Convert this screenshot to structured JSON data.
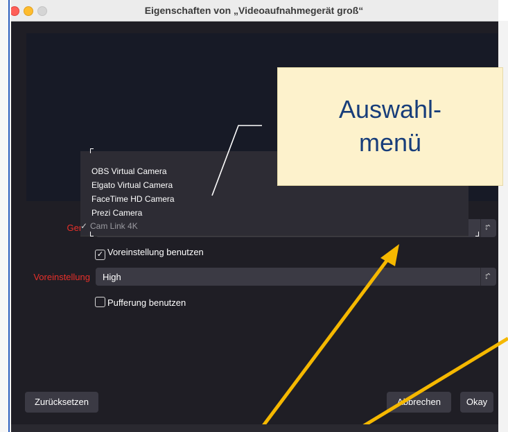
{
  "window": {
    "title": "Eigenschaften von „Videoaufnahmegerät groß“"
  },
  "device": {
    "label": "Gerät",
    "options": [
      "OBS Virtual Camera",
      "Elgato Virtual Camera",
      "FaceTime HD Camera",
      "Prezi Camera",
      "Cam Link 4K"
    ],
    "selected": "Cam Link 4K",
    "check_glyph": "✓"
  },
  "use_preset": {
    "label": "Voreinstellung benutzen",
    "checked": true
  },
  "preset": {
    "label": "Voreinstellung",
    "value": "High"
  },
  "buffering": {
    "label": "Pufferung benutzen",
    "checked": false
  },
  "buttons": {
    "reset": "Zurücksetzen",
    "cancel": "Abbrechen",
    "ok": "Okay"
  },
  "callout": {
    "line1": "Auswahl-",
    "line2": "menü"
  },
  "icons": {
    "updown": "chevron-up-down-icon",
    "check": "checkmark-icon"
  },
  "colors": {
    "window_bg": "#1f1e25",
    "label_red": "#e8302a",
    "callout_bg": "#fdf2cc",
    "callout_text": "#173d7a",
    "arrow": "#f5b800"
  }
}
